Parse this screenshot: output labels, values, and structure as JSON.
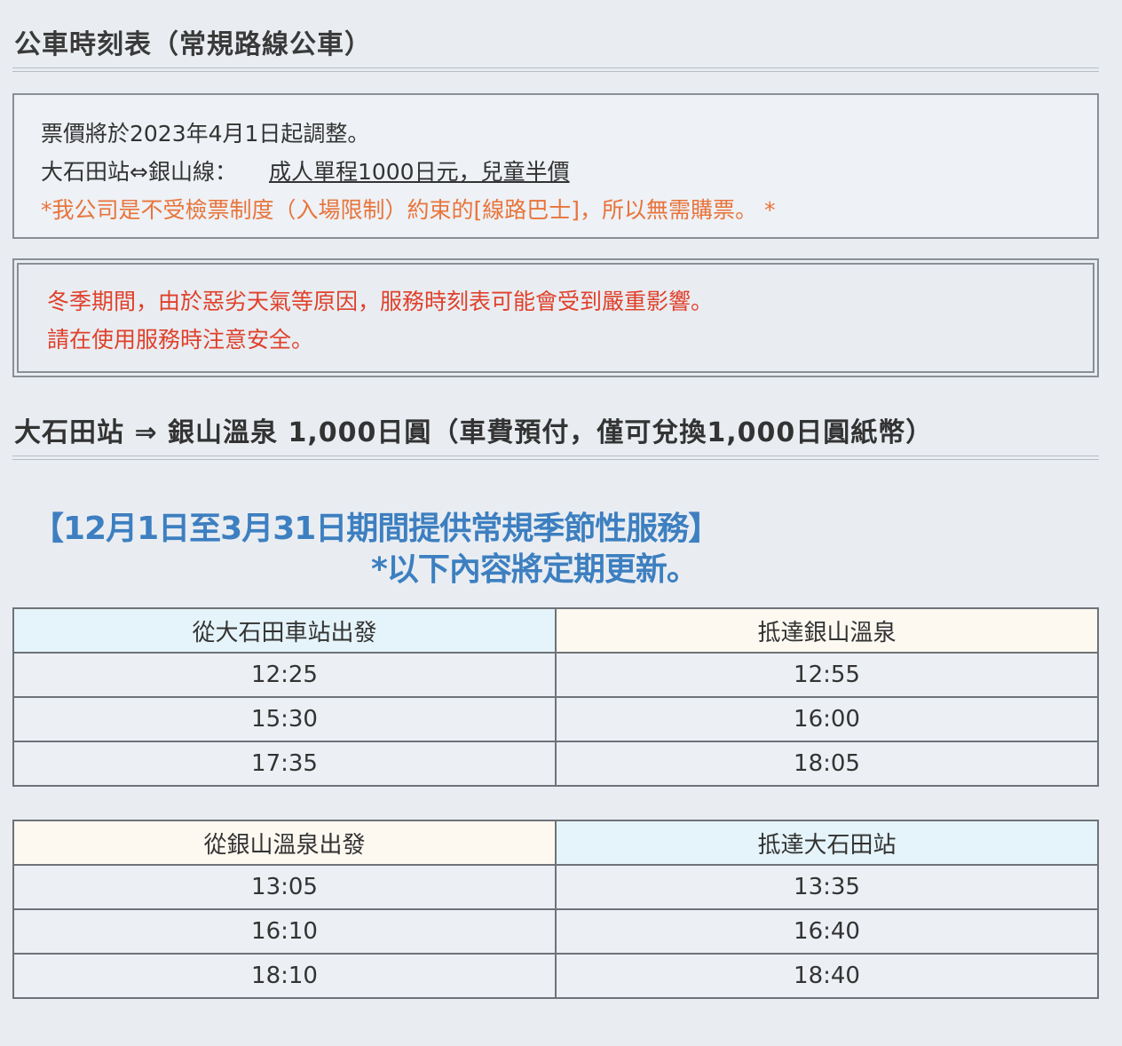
{
  "title": "公車時刻表（常規路線公車）",
  "notice": {
    "line1": "票價將於2023年4月1日起調整。",
    "route_label": "大石田站⇔銀山線：",
    "fare": "成人單程1000日元，兒童半價",
    "note": "*我公司是不受檢票制度（入場限制）約束的[線路巴士]，所以無需購票。 *"
  },
  "warning": {
    "line1": "冬季期間，由於惡劣天氣等原因，服務時刻表可能會受到嚴重影響。",
    "line2": "請在使用服務時注意安全。"
  },
  "route_heading": "大石田站 ⇒ 銀山溫泉 1,000日圓（車費預付，僅可兌換1,000日圓紙幣）",
  "season": {
    "line1": "【12月1日至3月31日期間提供常規季節性服務】",
    "line2": "*以下內容將定期更新。"
  },
  "table1": {
    "headers": [
      "從大石田車站出發",
      "抵達銀山溫泉"
    ],
    "rows": [
      [
        "12:25",
        "12:55"
      ],
      [
        "15:30",
        "16:00"
      ],
      [
        "17:35",
        "18:05"
      ]
    ]
  },
  "table2": {
    "headers": [
      "從銀山溫泉出發",
      "抵達大石田站"
    ],
    "rows": [
      [
        "13:05",
        "13:35"
      ],
      [
        "16:10",
        "16:40"
      ],
      [
        "18:10",
        "18:40"
      ]
    ]
  },
  "colors": {
    "orange_note": "#e8743b",
    "red_warning": "#e0402a",
    "blue_season": "#3d7fc0",
    "header_light_blue": "#e5f4fa",
    "header_cream": "#fdf9f1"
  }
}
